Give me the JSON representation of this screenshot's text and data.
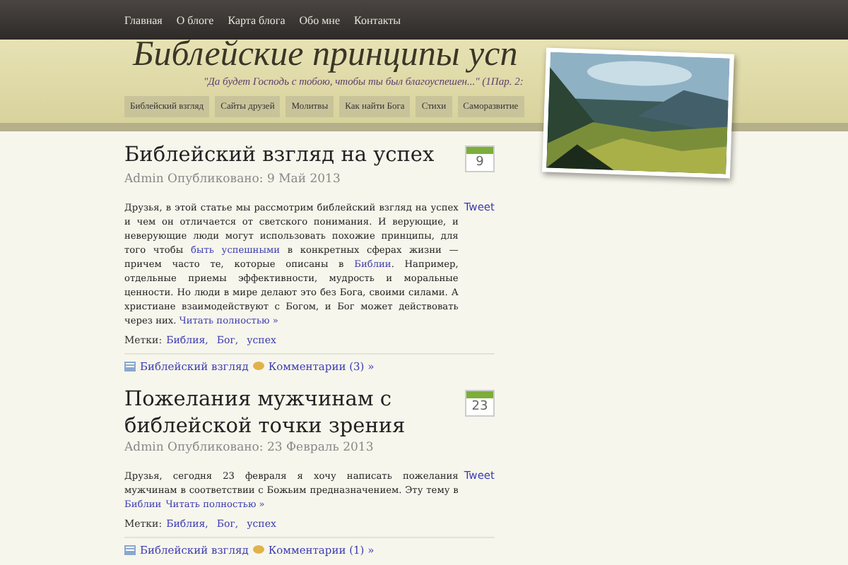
{
  "top_nav": [
    "Главная",
    "О блоге",
    "Карта блога",
    "Обо мне",
    "Контакты"
  ],
  "site_title": "Библейские принципы усп",
  "tagline": "\"Да будет Господь с тобою, чтобы ты был благоуспешен...\" (1Пар. 2:",
  "categories_nav": [
    "Библейский взгляд",
    "Сайты друзей",
    "Молитвы",
    "Как найти Бога",
    "Стихи",
    "Саморазвитие"
  ],
  "header_image": {
    "kind": "picture"
  },
  "posts": [
    {
      "title": "Библейский взгляд на успех",
      "meta": "Admin Опубликовано: 9 Май 2013",
      "day": "9",
      "tweet": "Tweet",
      "body": [
        {
          "text": "Друзья, в этой статье мы рассмотрим библейский взгляд на успех и чем он отличается от светского понимания. И верующие, и неверующие люди могут использовать похожие принципы, для того чтобы ",
          "link": false
        },
        {
          "text": "быть успешными",
          "link": true
        },
        {
          "text": " в конкретных сферах жизни — причем часто те, которые описаны в ",
          "link": false
        },
        {
          "text": "Библии",
          "link": true
        },
        {
          "text": ". Например, отдельные приемы эффективности, мудрость и моральные ценности. Но люди в мире делают это без Бога, своими силами. А христиане  взаимодействуют с Богом, и Бог может действовать через них. ",
          "link": false
        },
        {
          "text": "Читать полностью »",
          "link": true
        }
      ],
      "tags_label": "Метки:",
      "tags": [
        "Библия,",
        "Бог,",
        "успех"
      ],
      "category": "Библейский взгляд",
      "comments": "Комментарии (3) »"
    },
    {
      "title": "Пожелания мужчинам с библейской точки зрения",
      "meta": "Admin Опубликовано: 23 Февраль 2013",
      "day": "23",
      "tweet": "Tweet",
      "body": [
        {
          "text": "Друзья, сегодня 23 февраля я хочу написать пожелания мужчинам в соответствии с Божьим предназначением. Эту тему в ",
          "link": false
        },
        {
          "text": "Библии",
          "link": true
        },
        {
          "text": "Читать полностью »",
          "link": true
        }
      ],
      "tags_label": "Метки:",
      "tags": [
        "Библия,",
        "Бог,",
        "успех"
      ],
      "category": "Библейский взгляд",
      "comments": "Комментарии (1) »"
    }
  ]
}
